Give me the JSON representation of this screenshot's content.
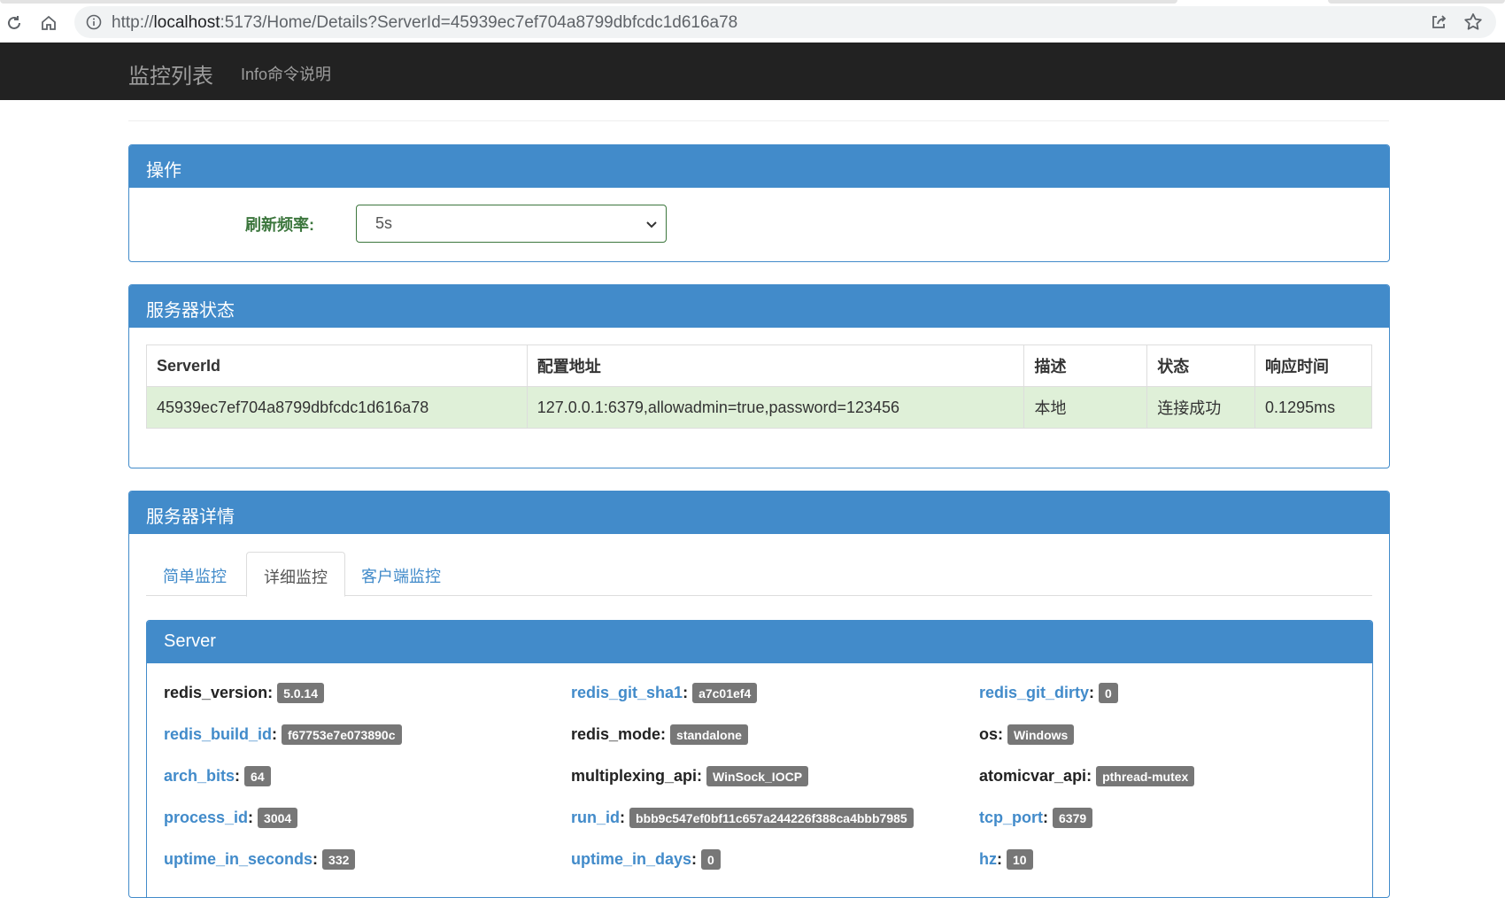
{
  "browser": {
    "url_prefix": "http://",
    "url_host": "localhost",
    "url_rest": ":5173/Home/Details?ServerId=45939ec7ef704a8799dbfcdc1d616a78"
  },
  "navbar": {
    "brand": "监控列表",
    "link": "Info命令说明"
  },
  "operation_panel": {
    "title": "操作",
    "refresh_label": "刷新频率:",
    "refresh_value": "5s"
  },
  "status_panel": {
    "title": "服务器状态",
    "headers": [
      "ServerId",
      "配置地址",
      "描述",
      "状态",
      "响应时间"
    ],
    "row": [
      "45939ec7ef704a8799dbfcdc1d616a78",
      "127.0.0.1:6379,allowadmin=true,password=123456",
      "本地",
      "连接成功",
      "0.1295ms"
    ]
  },
  "details_panel": {
    "title": "服务器详情",
    "tabs": [
      "简单监控",
      "详细监控",
      "客户端监控"
    ],
    "active_tab": "详细监控",
    "server": {
      "title": "Server",
      "fields": [
        {
          "key": "redis_version",
          "sep": " :",
          "value": "5.0.14",
          "link": false
        },
        {
          "key": "redis_git_sha1",
          "sep": ":",
          "value": "a7c01ef4",
          "link": true
        },
        {
          "key": "redis_git_dirty",
          "sep": ":",
          "value": "0",
          "link": true
        },
        {
          "key": "redis_build_id",
          "sep": ":",
          "value": "f67753e7e073890c",
          "link": true
        },
        {
          "key": "redis_mode",
          "sep": " :",
          "value": "standalone",
          "link": false
        },
        {
          "key": "os",
          "sep": " :",
          "value": "Windows",
          "link": false
        },
        {
          "key": "arch_bits",
          "sep": ":",
          "value": "64",
          "link": true
        },
        {
          "key": "multiplexing_api",
          "sep": " :",
          "value": "WinSock_IOCP",
          "link": false
        },
        {
          "key": "atomicvar_api",
          "sep": " :",
          "value": "pthread-mutex",
          "link": false
        },
        {
          "key": "process_id",
          "sep": ":",
          "value": "3004",
          "link": true
        },
        {
          "key": "run_id",
          "sep": ":",
          "value": "bbb9c547ef0bf11c657a244226f388ca4bbb7985",
          "link": true
        },
        {
          "key": "tcp_port",
          "sep": ":",
          "value": "6379",
          "link": true
        },
        {
          "key": "uptime_in_seconds",
          "sep": ":",
          "value": "332",
          "link": true
        },
        {
          "key": "uptime_in_days",
          "sep": ":",
          "value": "0",
          "link": true
        },
        {
          "key": "hz",
          "sep": ":",
          "value": "10",
          "link": true
        }
      ]
    }
  }
}
